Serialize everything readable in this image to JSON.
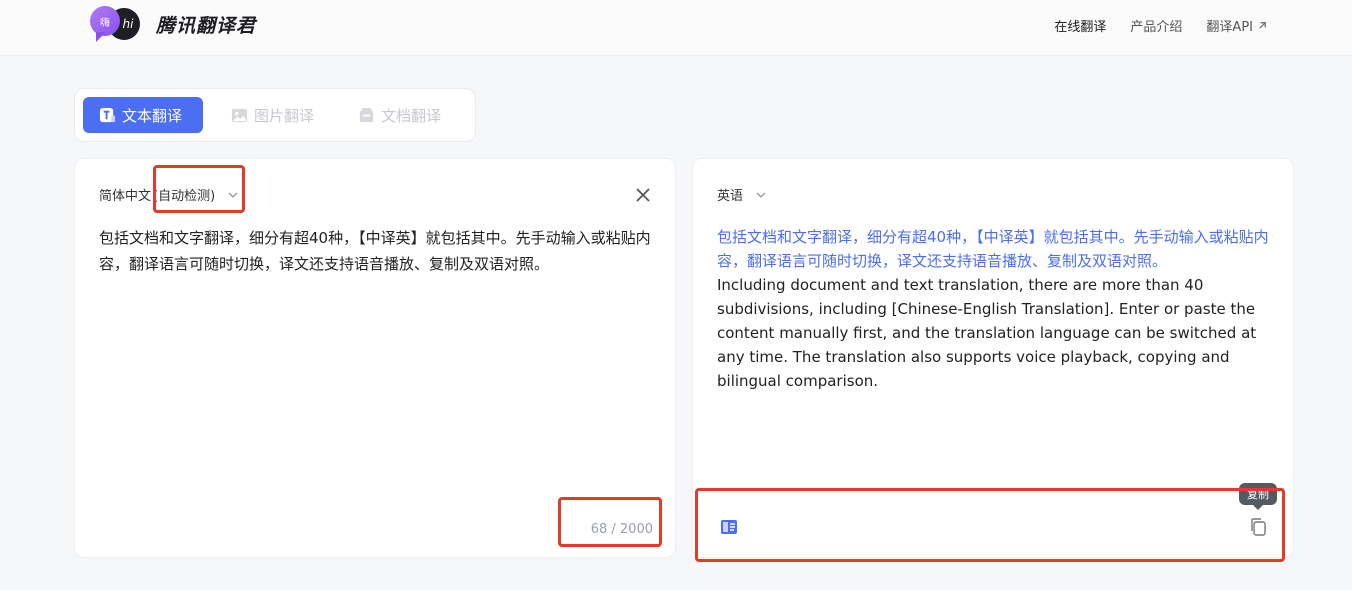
{
  "header": {
    "logo_bubble_a": "嗨",
    "logo_bubble_b": "hi",
    "logo_text": "腾讯翻译君",
    "nav": [
      {
        "label": "在线翻译"
      },
      {
        "label": "产品介绍"
      },
      {
        "label": "翻译API"
      }
    ]
  },
  "tabs": [
    {
      "label": "文本翻译",
      "active": true,
      "icon": "text-icon"
    },
    {
      "label": "图片翻译",
      "active": false,
      "icon": "image-icon"
    },
    {
      "label": "文档翻译",
      "active": false,
      "icon": "document-icon"
    }
  ],
  "source": {
    "language": "简体中文",
    "auto_detect": "(自动检测)",
    "text": "包括文档和文字翻译，细分有超40种，【中译英】就包括其中。先手动输入或粘贴内容，翻译语言可随时切换，译文还支持语音播放、复制及双语对照。",
    "counter": "68 / 2000"
  },
  "target": {
    "language": "英语",
    "text_zh": "包括文档和文字翻译，细分有超40种，【中译英】就包括其中。先手动输入或粘贴内容，翻译语言可随时切换，译文还支持语音播放、复制及双语对照。",
    "text_en": "Including document and text translation, there are more than 40 subdivisions, including [Chinese-English Translation]. Enter or paste the content manually first, and the translation language can be switched at any time. The translation also supports voice playback, copying and bilingual comparison.",
    "copy_tooltip": "复制"
  },
  "colors": {
    "accent": "#4c6ef0",
    "highlight": "#e23b2a"
  }
}
